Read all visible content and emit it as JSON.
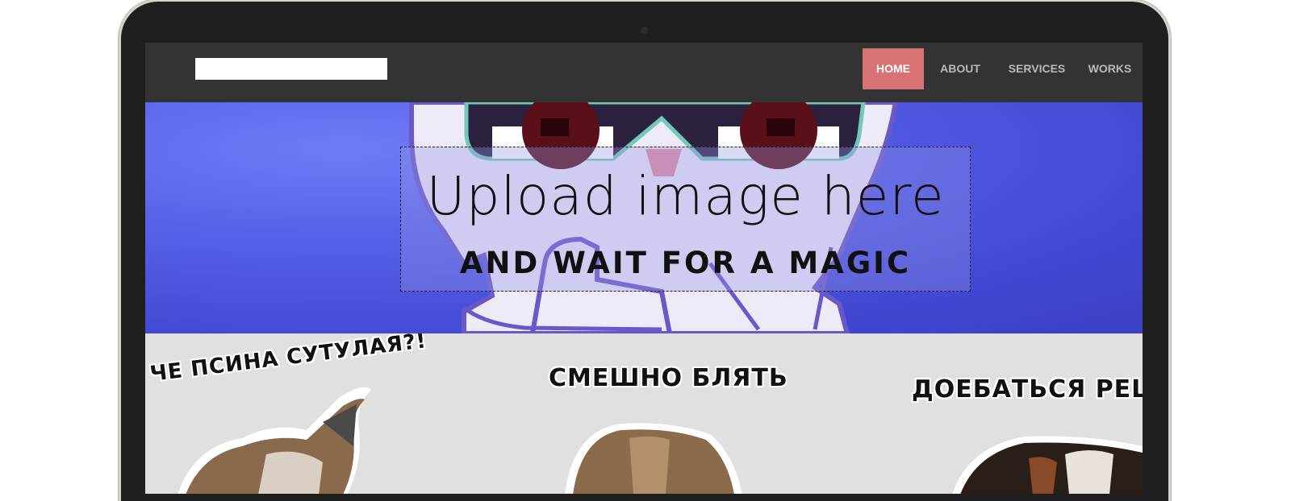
{
  "navbar": {
    "logo": "",
    "items": [
      {
        "label": "HOME",
        "active": true
      },
      {
        "label": "ABOUT",
        "active": false
      },
      {
        "label": "SERVICES",
        "active": false
      },
      {
        "label": "WORKS",
        "active": false
      }
    ]
  },
  "hero": {
    "upload_title": "Upload image here",
    "upload_subtitle": "AND WAIT FOR A MAGIC"
  },
  "gallery": {
    "stickers": [
      {
        "caption": "ЧЕ ПСИНА СУТУЛАЯ?!"
      },
      {
        "caption": "СМЕШНО БЛЯТЬ"
      },
      {
        "caption": "ДОЕБАТЬСЯ РЕШ"
      }
    ]
  },
  "colors": {
    "navbar_bg": "#333333",
    "active_nav": "#d87375",
    "hero_blue": "#5660e8",
    "gallery_bg": "#e0e0e0"
  }
}
